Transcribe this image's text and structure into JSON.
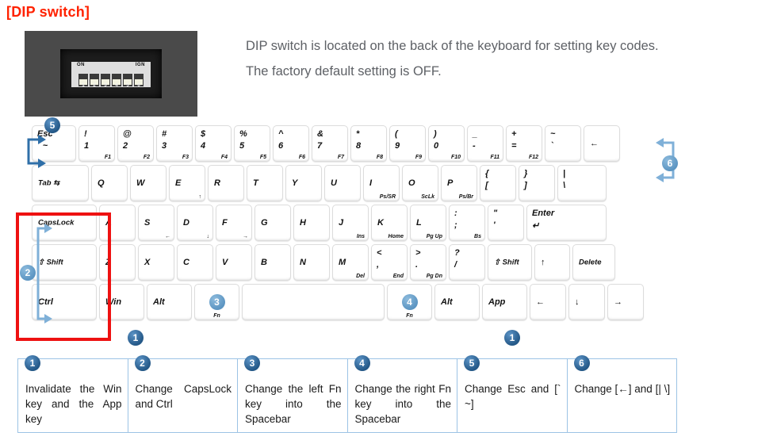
{
  "title": "[DIP switch]",
  "description": {
    "line1": "DIP switch is located on the back of the keyboard for setting key codes.",
    "line2": "The factory default setting is OFF."
  },
  "dip_photo": {
    "label_on": "ON",
    "label_ign": "IGN",
    "switch_numbers": [
      "1",
      "2",
      "3",
      "4",
      "5",
      "6"
    ]
  },
  "colors": {
    "title": "#ff2200",
    "badge": "#2a6099",
    "badge_light": "#5c95c2",
    "highlight_box": "#ee1111",
    "table_border": "#9cc3e5",
    "body_text": "#5e6166"
  },
  "keyboard": {
    "row_function": [
      {
        "main": "Esc",
        "sec": "`    ~",
        "style": "esc"
      },
      {
        "main": "!",
        "sec": "1",
        "fn": "F1"
      },
      {
        "main": "@",
        "sec": "2",
        "fn": "F2"
      },
      {
        "main": "#",
        "sec": "3",
        "fn": "F3"
      },
      {
        "main": "$",
        "sec": "4",
        "fn": "F4"
      },
      {
        "main": "%",
        "sec": "5",
        "fn": "F5"
      },
      {
        "main": "^",
        "sec": "6",
        "fn": "F6"
      },
      {
        "main": "&",
        "sec": "7",
        "fn": "F7"
      },
      {
        "main": "*",
        "sec": "8",
        "fn": "F8"
      },
      {
        "main": "(",
        "sec": "9",
        "fn": "F9"
      },
      {
        "main": ")",
        "sec": "0",
        "fn": "F10"
      },
      {
        "main": "_",
        "sec": "-",
        "fn": "F11"
      },
      {
        "main": "+",
        "sec": "=",
        "fn": "F12"
      },
      {
        "main": "~",
        "sec": "`"
      },
      {
        "main": "←"
      }
    ],
    "row_qwerty": [
      {
        "main": "Tab ⇆"
      },
      {
        "main": "Q"
      },
      {
        "main": "W"
      },
      {
        "main": "E",
        "fn": "↑"
      },
      {
        "main": "R"
      },
      {
        "main": "T"
      },
      {
        "main": "Y"
      },
      {
        "main": "U"
      },
      {
        "main": "I",
        "fn": "Ps/SR"
      },
      {
        "main": "O",
        "fn": "ScLk"
      },
      {
        "main": "P",
        "fn": "Ps/Br"
      },
      {
        "main": "{",
        "sec": "["
      },
      {
        "main": "}",
        "sec": "]"
      },
      {
        "main": "|",
        "sec": "\\"
      }
    ],
    "row_home": [
      {
        "main": "CapsLock"
      },
      {
        "main": "A"
      },
      {
        "main": "S",
        "fn": "←"
      },
      {
        "main": "D",
        "fn": "↓"
      },
      {
        "main": "F",
        "fn": "→"
      },
      {
        "main": "G"
      },
      {
        "main": "H"
      },
      {
        "main": "J",
        "fn": "Ins"
      },
      {
        "main": "K",
        "fn": "Home"
      },
      {
        "main": "L",
        "fn": "Pg Up"
      },
      {
        "main": ":",
        "sec": ";",
        "fn": "Bs"
      },
      {
        "main": "\"",
        "sec": "'"
      },
      {
        "main": "Enter",
        "sec": "↵"
      }
    ],
    "row_shift": [
      {
        "main": "⇧ Shift"
      },
      {
        "main": "Z"
      },
      {
        "main": "X"
      },
      {
        "main": "C"
      },
      {
        "main": "V"
      },
      {
        "main": "B"
      },
      {
        "main": "N"
      },
      {
        "main": "M",
        "fn": "Del"
      },
      {
        "main": "<",
        "sec": ",",
        "fn": "End"
      },
      {
        "main": ">",
        "sec": ".",
        "fn": "Pg Dn"
      },
      {
        "main": "?",
        "sec": "/"
      },
      {
        "main": "⇧ Shift"
      },
      {
        "main": "↑"
      },
      {
        "main": "Delete"
      }
    ],
    "row_bottom": [
      {
        "main": "Ctrl"
      },
      {
        "main": "Win"
      },
      {
        "main": "Alt"
      },
      {
        "main": "",
        "fn": "Fn",
        "badge": "3"
      },
      {
        "main": ""
      },
      {
        "main": "",
        "fn": "Fn",
        "badge": "4"
      },
      {
        "main": "Alt"
      },
      {
        "main": "App"
      },
      {
        "main": "←"
      },
      {
        "main": "↓"
      },
      {
        "main": "→"
      }
    ],
    "callout_badges": {
      "esc": "5",
      "right_bracket": "6",
      "left_group": "2",
      "win": "1",
      "app": "1",
      "left_fn": "3",
      "right_fn": "4"
    }
  },
  "legend": [
    {
      "number": "1",
      "text": "Invalidate the Win key and the App key"
    },
    {
      "number": "2",
      "text": "Change CapsLock and Ctrl"
    },
    {
      "number": "3",
      "text": "Change the left Fn key into the Spacebar"
    },
    {
      "number": "4",
      "text": "Change the right Fn key into the Spacebar"
    },
    {
      "number": "5",
      "text": "Change Esc and [` ~]"
    },
    {
      "number": "6",
      "text": "Change [←] and [| \\]"
    }
  ]
}
